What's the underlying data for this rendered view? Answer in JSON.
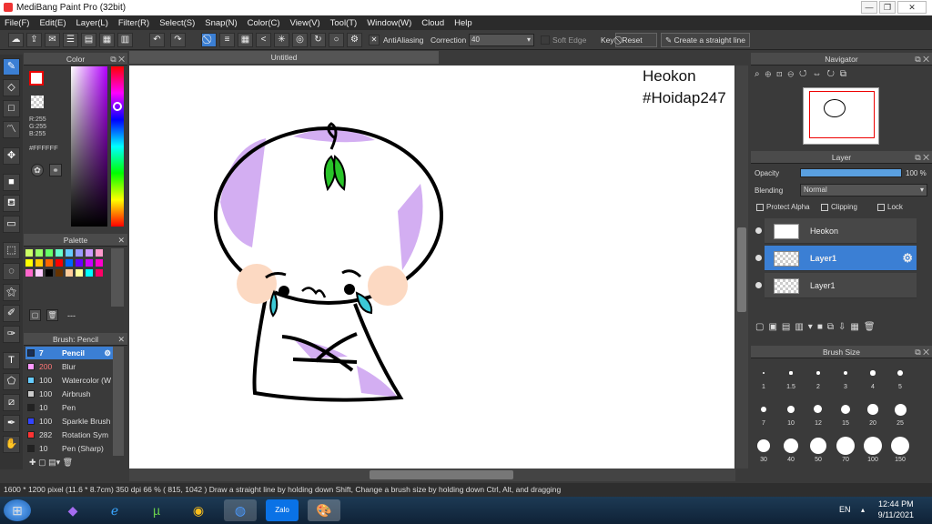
{
  "window": {
    "title": "MediBang Paint Pro (32bit)",
    "minimize": "—",
    "maximize": "❐",
    "close": "✕"
  },
  "menu": [
    "File(F)",
    "Edit(E)",
    "Layer(L)",
    "Filter(R)",
    "Select(S)",
    "Snap(N)",
    "Color(C)",
    "View(V)",
    "Tool(T)",
    "Window(W)",
    "Cloud",
    "Help"
  ],
  "toolbar": {
    "antialiasing": "AntiAliasing",
    "correction_label": "Correction",
    "correction_value": "40",
    "soft_edge": "Soft Edge",
    "key": "Key",
    "reset": "Reset",
    "straight_line": "Create a straight line"
  },
  "color_panel": {
    "title": "Color",
    "r": "R:255",
    "g": "G:255",
    "b": "B:255",
    "hex": "#FFFFFF"
  },
  "palette_panel": {
    "title": "Palette",
    "swatches": [
      "#ccff66",
      "#99ff66",
      "#66ff66",
      "#66ffcc",
      "#66ccff",
      "#9999ff",
      "#cc99ff",
      "#ff99cc",
      "#ffff00",
      "#ffcc00",
      "#ff6600",
      "#ff0000",
      "#0066ff",
      "#6600ff",
      "#cc00ff",
      "#ff00cc",
      "#ff66cc",
      "#ffccff",
      "#000000",
      "#663300",
      "#ffcc99",
      "#ffff99",
      "#00ffff",
      "#ff0066"
    ],
    "more": "---"
  },
  "brush_panel": {
    "title": "Brush: Pencil",
    "items": [
      {
        "size": "7",
        "name": "Pencil",
        "color": "#1a2f55"
      },
      {
        "size": "200",
        "name": "Blur",
        "color": "#ff99ff"
      },
      {
        "size": "100",
        "name": "Watercolor (W",
        "color": "#66ccff"
      },
      {
        "size": "100",
        "name": "Airbrush",
        "color": "#cccccc"
      },
      {
        "size": "10",
        "name": "Pen",
        "color": "#222222"
      },
      {
        "size": "100",
        "name": "Sparkle Brush",
        "color": "#3344ff"
      },
      {
        "size": "282",
        "name": "Rotation Sym",
        "color": "#ff3333"
      },
      {
        "size": "10",
        "name": "Pen (Sharp)",
        "color": "#222222"
      }
    ]
  },
  "document": {
    "tab": "Untitled",
    "canvas_text_line1": "Heokon",
    "canvas_text_line2": "#Hoidap247"
  },
  "navigator": {
    "title": "Navigator"
  },
  "layer_panel": {
    "title": "Layer",
    "opacity_label": "Opacity",
    "opacity_value": "100 %",
    "opacity_fraction": 1.0,
    "blending_label": "Blending",
    "blending_value": "Normal",
    "protect_alpha": "Protect Alpha",
    "clipping": "Clipping",
    "lock": "Lock",
    "layers": [
      {
        "name": "Heokon",
        "selected": false
      },
      {
        "name": "Layer1",
        "selected": true
      },
      {
        "name": "Layer1",
        "selected": false
      }
    ]
  },
  "brush_size_panel": {
    "title": "Brush Size",
    "sizes": [
      "1",
      "1.5",
      "2",
      "3",
      "4",
      "5",
      "7",
      "10",
      "12",
      "15",
      "20",
      "25",
      "30",
      "40",
      "50",
      "70",
      "100",
      "150"
    ]
  },
  "status": {
    "text": "1600 * 1200 pixel   (11.6 * 8.7cm)   350 dpi   66 %   ( 815, 1042 )   Draw a straight line by holding down Shift, Change a brush size by holding down Ctrl, Alt, and dragging"
  },
  "taskbar": {
    "lang": "EN",
    "time": "12:44 PM",
    "date": "9/11/2021",
    "zalo": "Zalo"
  }
}
